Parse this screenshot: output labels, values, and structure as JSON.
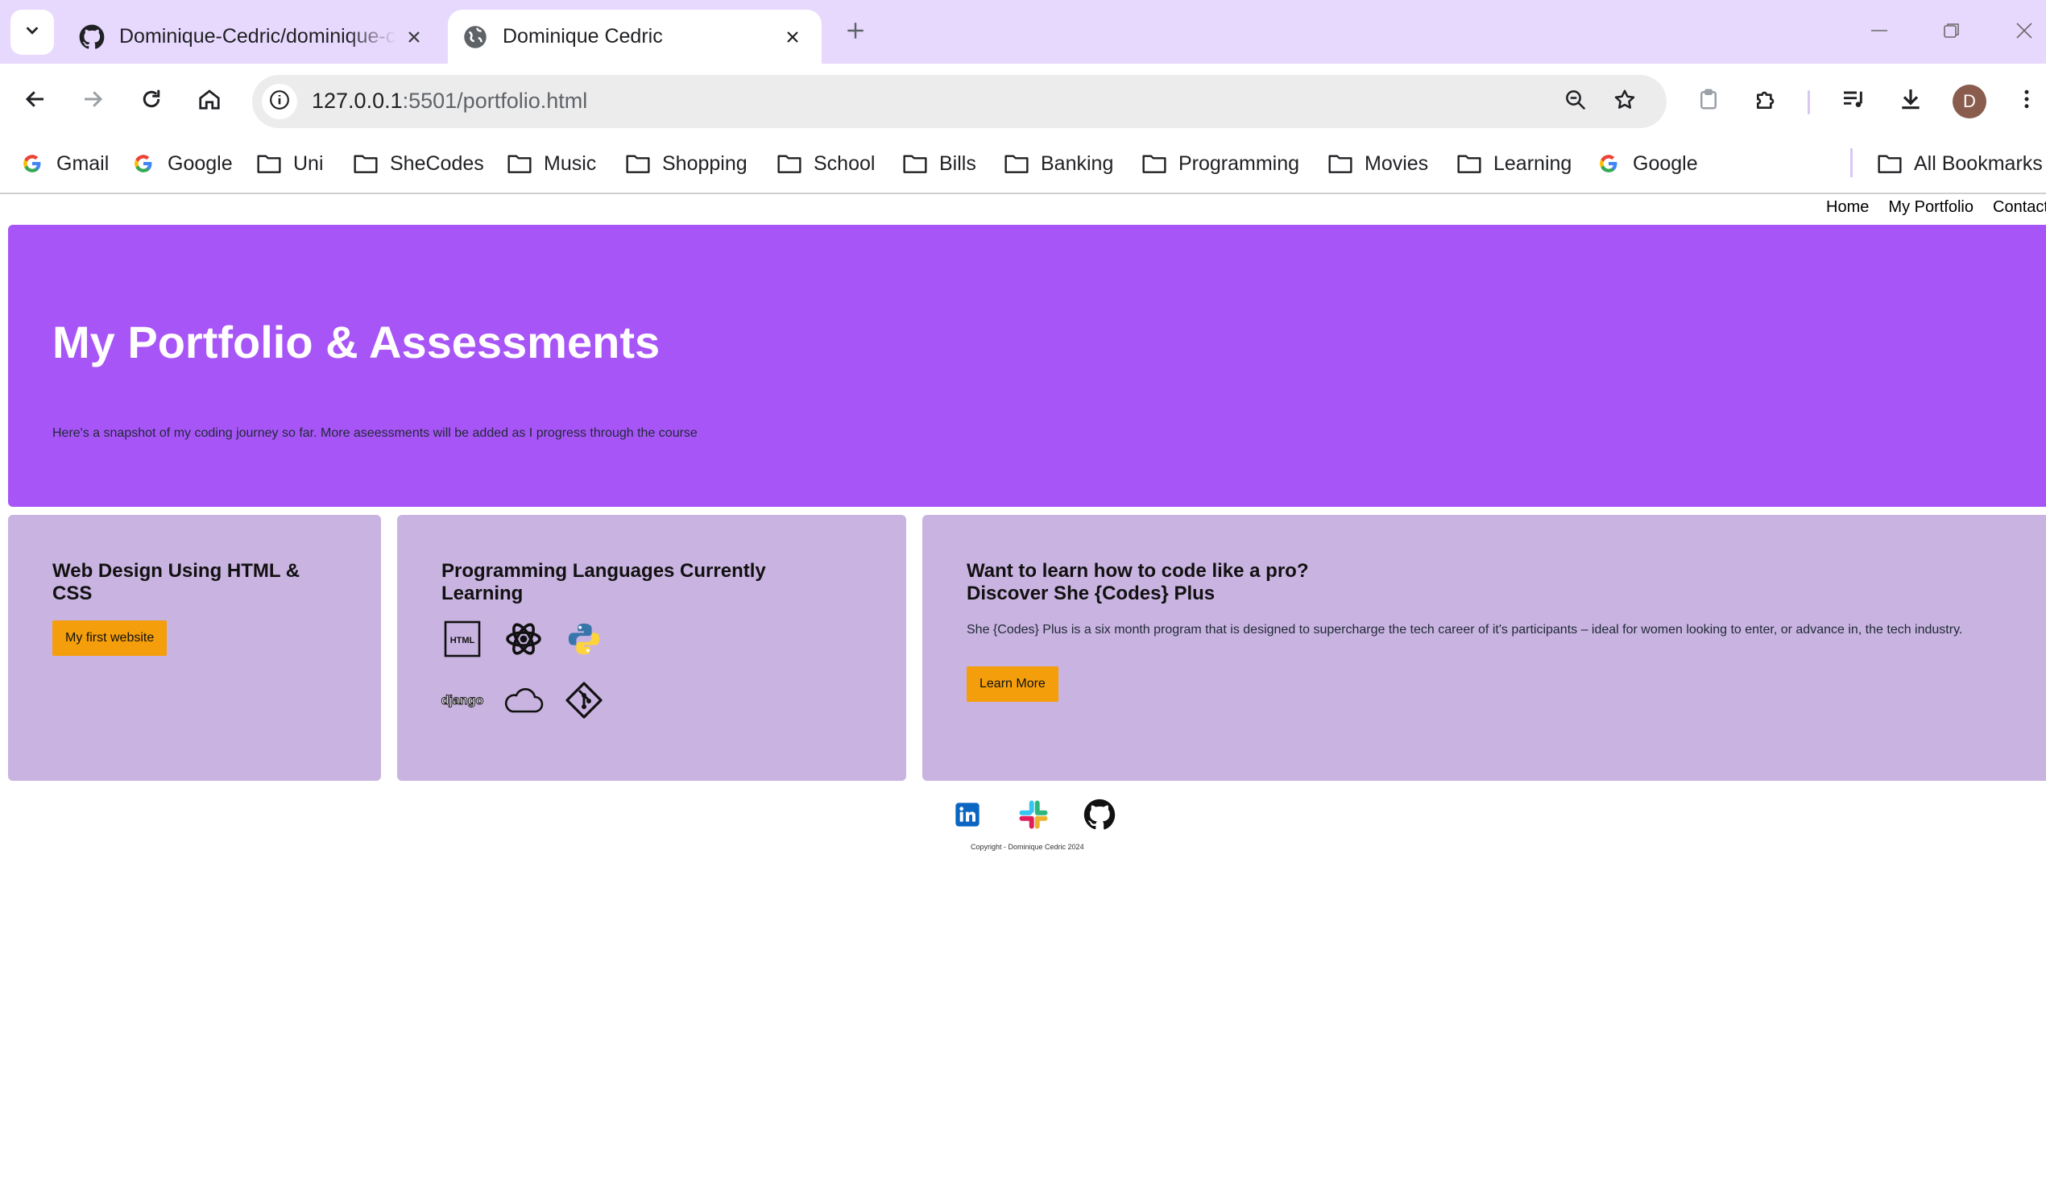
{
  "browser": {
    "tabs": [
      {
        "title": "Dominique-Cedric/dominique-cedric",
        "icon": "github-icon",
        "active": false
      },
      {
        "title": "Dominique Cedric",
        "icon": "globe-icon",
        "active": true
      }
    ],
    "url_host": "127.0.0.1",
    "url_rest": ":5501/portfolio.html",
    "avatar_letter": "D",
    "bookmarks": [
      {
        "label": "Gmail",
        "icon": "google-icon"
      },
      {
        "label": "Google",
        "icon": "google-icon"
      },
      {
        "label": "Uni",
        "icon": "folder-icon"
      },
      {
        "label": "SheCodes",
        "icon": "folder-icon"
      },
      {
        "label": "Music",
        "icon": "folder-icon"
      },
      {
        "label": "Shopping",
        "icon": "folder-icon"
      },
      {
        "label": "School",
        "icon": "folder-icon"
      },
      {
        "label": "Bills",
        "icon": "folder-icon"
      },
      {
        "label": "Banking",
        "icon": "folder-icon"
      },
      {
        "label": "Programming",
        "icon": "folder-icon"
      },
      {
        "label": "Movies",
        "icon": "folder-icon"
      },
      {
        "label": "Learning",
        "icon": "folder-icon"
      },
      {
        "label": "Google",
        "icon": "google-icon"
      }
    ],
    "all_bookmarks": "All Bookmarks",
    "colors": {
      "chrome": "#e7d9fd",
      "omnibox": "#ececec"
    }
  },
  "site": {
    "nav": [
      "Home",
      "My Portfolio",
      "Contact"
    ],
    "hero": {
      "title": "My Portfolio & Assessments",
      "subtitle": "Here's a snapshot of my coding journey so far. More aseessments will be added as I progress through the course"
    },
    "cards": {
      "web": {
        "title": "Web Design Using HTML & CSS",
        "button": "My first website"
      },
      "langs": {
        "title": "Programming Languages Currently Learning",
        "icons": [
          "html-icon",
          "react-icon",
          "python-icon",
          "django-icon",
          "cloud-icon",
          "git-icon"
        ]
      },
      "shecodes": {
        "title_line1": "Want to learn how to code like a pro?",
        "title_line2": "Discover She {Codes} Plus",
        "body": "She {Codes} Plus is a six month program that is designed to supercharge the tech career of it's participants – ideal for women looking to enter, or advance in, the tech industry.",
        "button": "Learn More"
      }
    },
    "footer": {
      "icons": [
        "linkedin-icon",
        "slack-icon",
        "github-icon"
      ],
      "copyright": "Copyright - Dominique Cedric 2024"
    },
    "colors": {
      "hero": "#a855f7",
      "card": "#c9b3e0",
      "button": "#f59e0b"
    }
  }
}
